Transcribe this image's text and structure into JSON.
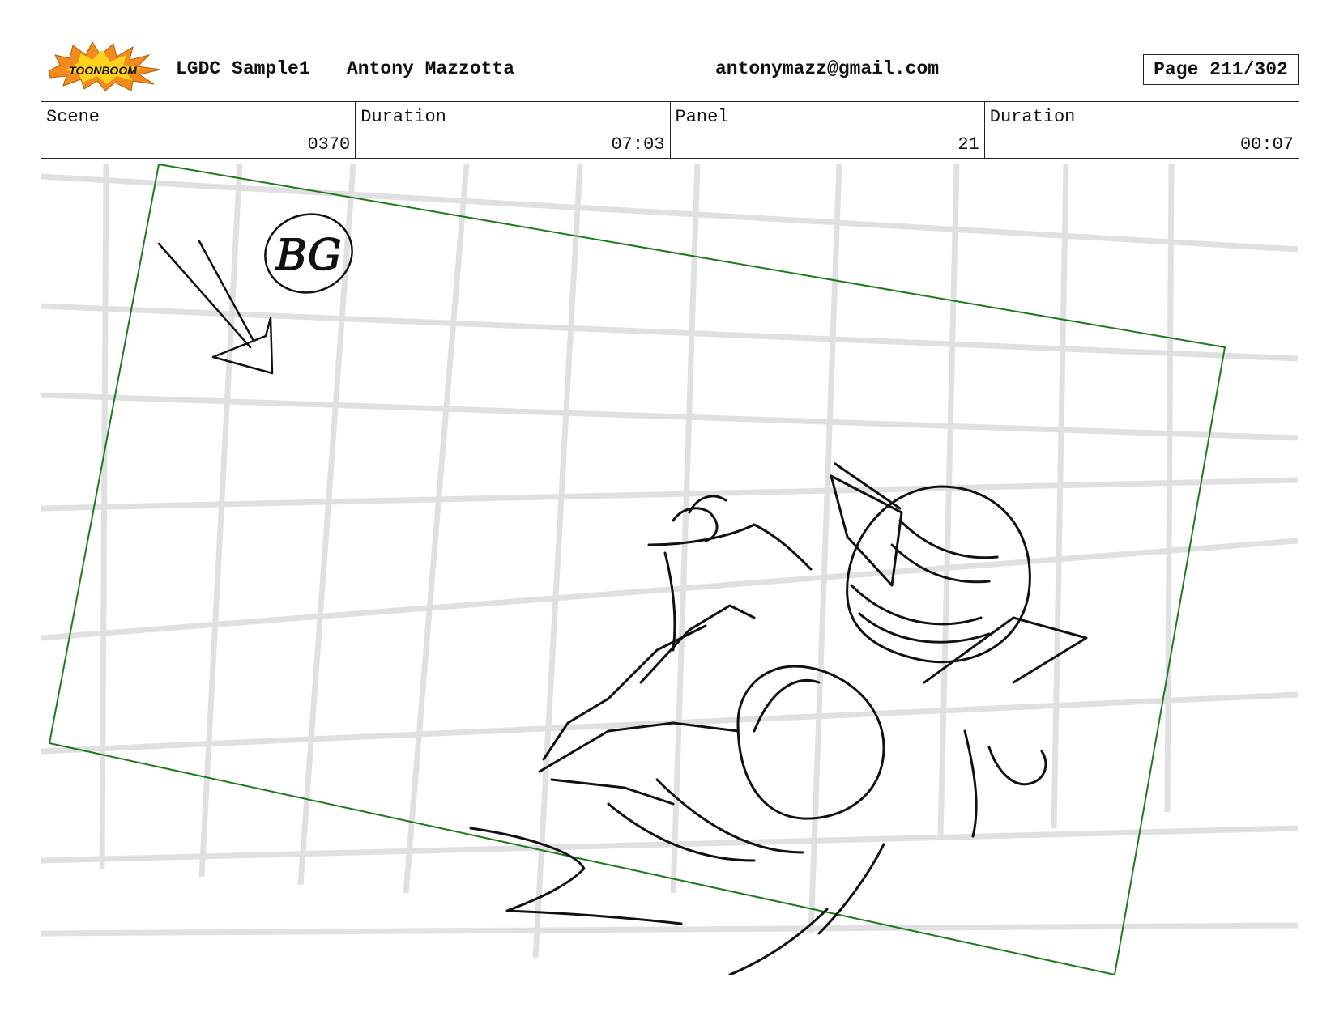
{
  "header": {
    "logo_text": "TOONBOOM",
    "project": "LGDC Sample1",
    "author": "Antony Mazzotta",
    "email": "antonymazz@gmail.com",
    "page": "Page 211/302"
  },
  "info": {
    "scene_label": "Scene",
    "scene_value": "0370",
    "scene_duration_label": "Duration",
    "scene_duration_value": "07:03",
    "panel_label": "Panel",
    "panel_value": "21",
    "panel_duration_label": "Duration",
    "panel_duration_value": "00:07"
  },
  "panel": {
    "sketch_note": "BG",
    "frame_color": "#1e7a1e",
    "grid_color": "#c8c8c8",
    "ink_color": "#111111"
  },
  "colors": {
    "logo_orange": "#f08c1e",
    "logo_yellow": "#ffd21e"
  }
}
